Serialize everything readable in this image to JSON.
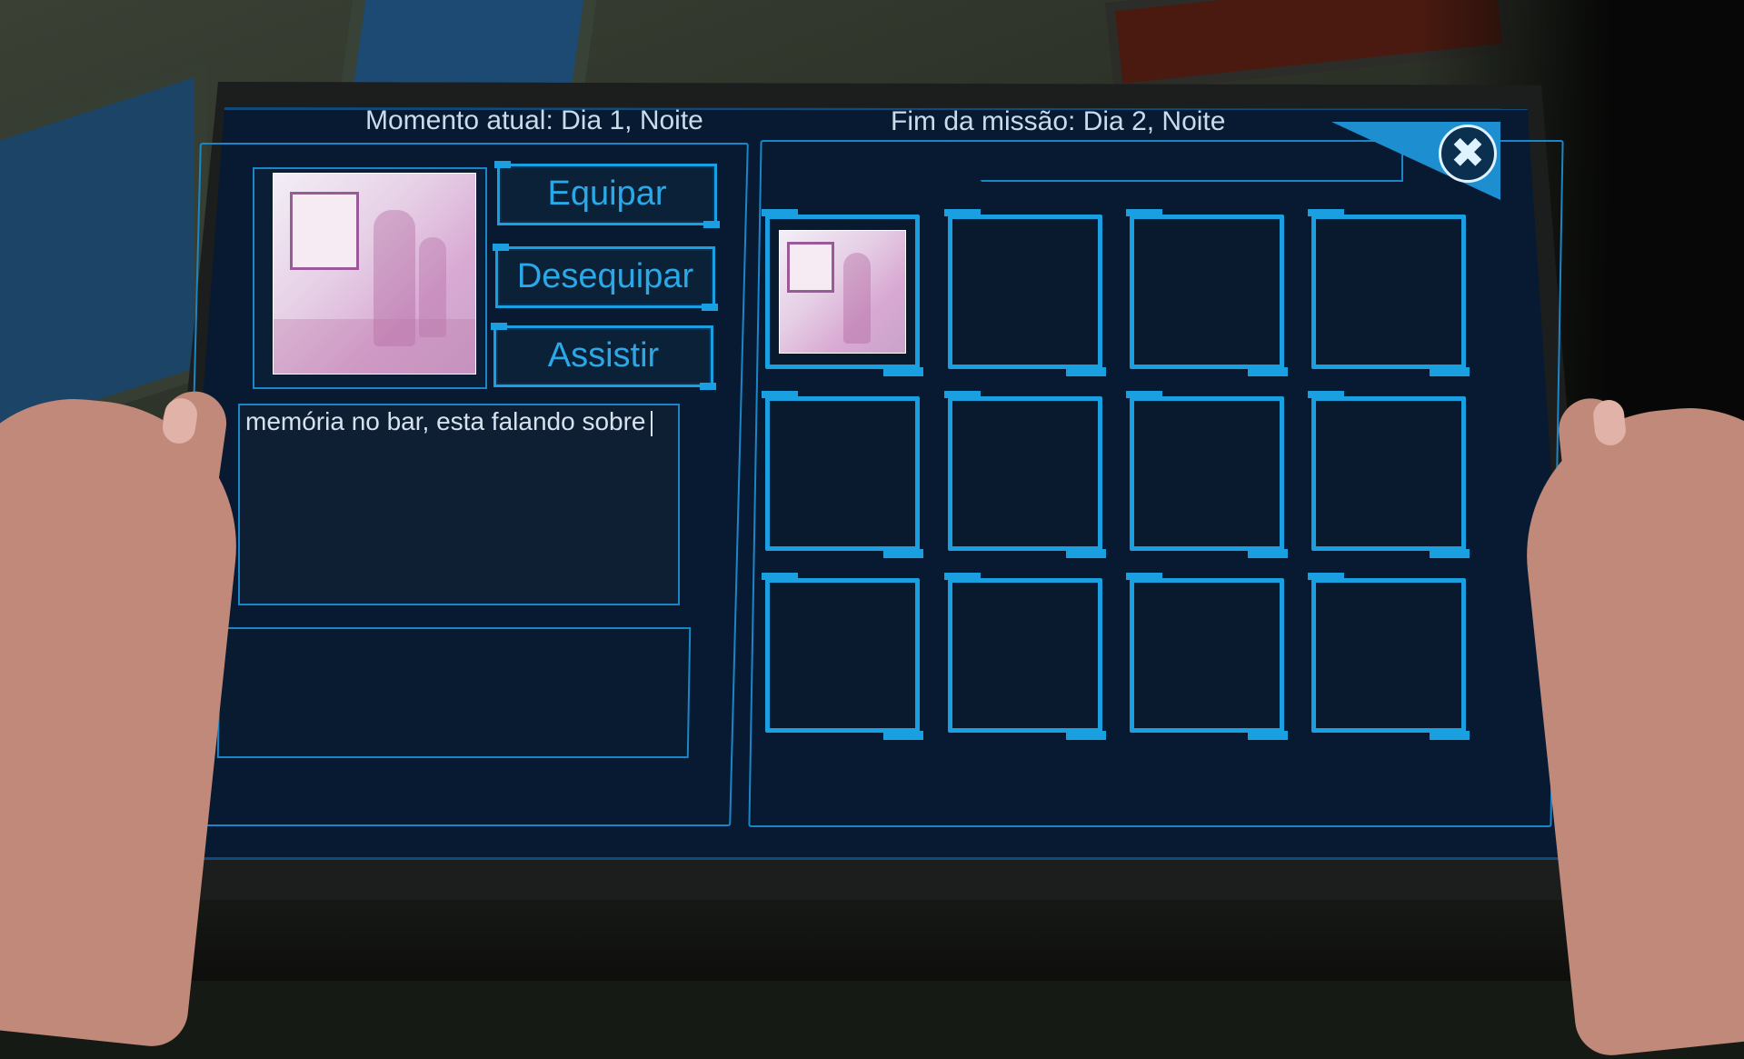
{
  "header": {
    "current_moment": "Momento atual: Dia 1, Noite",
    "mission_end": "Fim da missão: Dia 2, Noite"
  },
  "buttons": {
    "equip": "Equipar",
    "unequip": "Desequipar",
    "watch": "Assistir",
    "close_icon": "close-x-icon"
  },
  "selected_memory": {
    "description": "memória no bar, esta falando sobre"
  },
  "inventory": {
    "rows": 3,
    "columns": 4,
    "filled_slots": [
      0
    ],
    "accent_color": "#1aa0e0"
  },
  "colors": {
    "screen_bg": "#071a31",
    "accent": "#1aa0e0",
    "text": "#c9dcec"
  }
}
